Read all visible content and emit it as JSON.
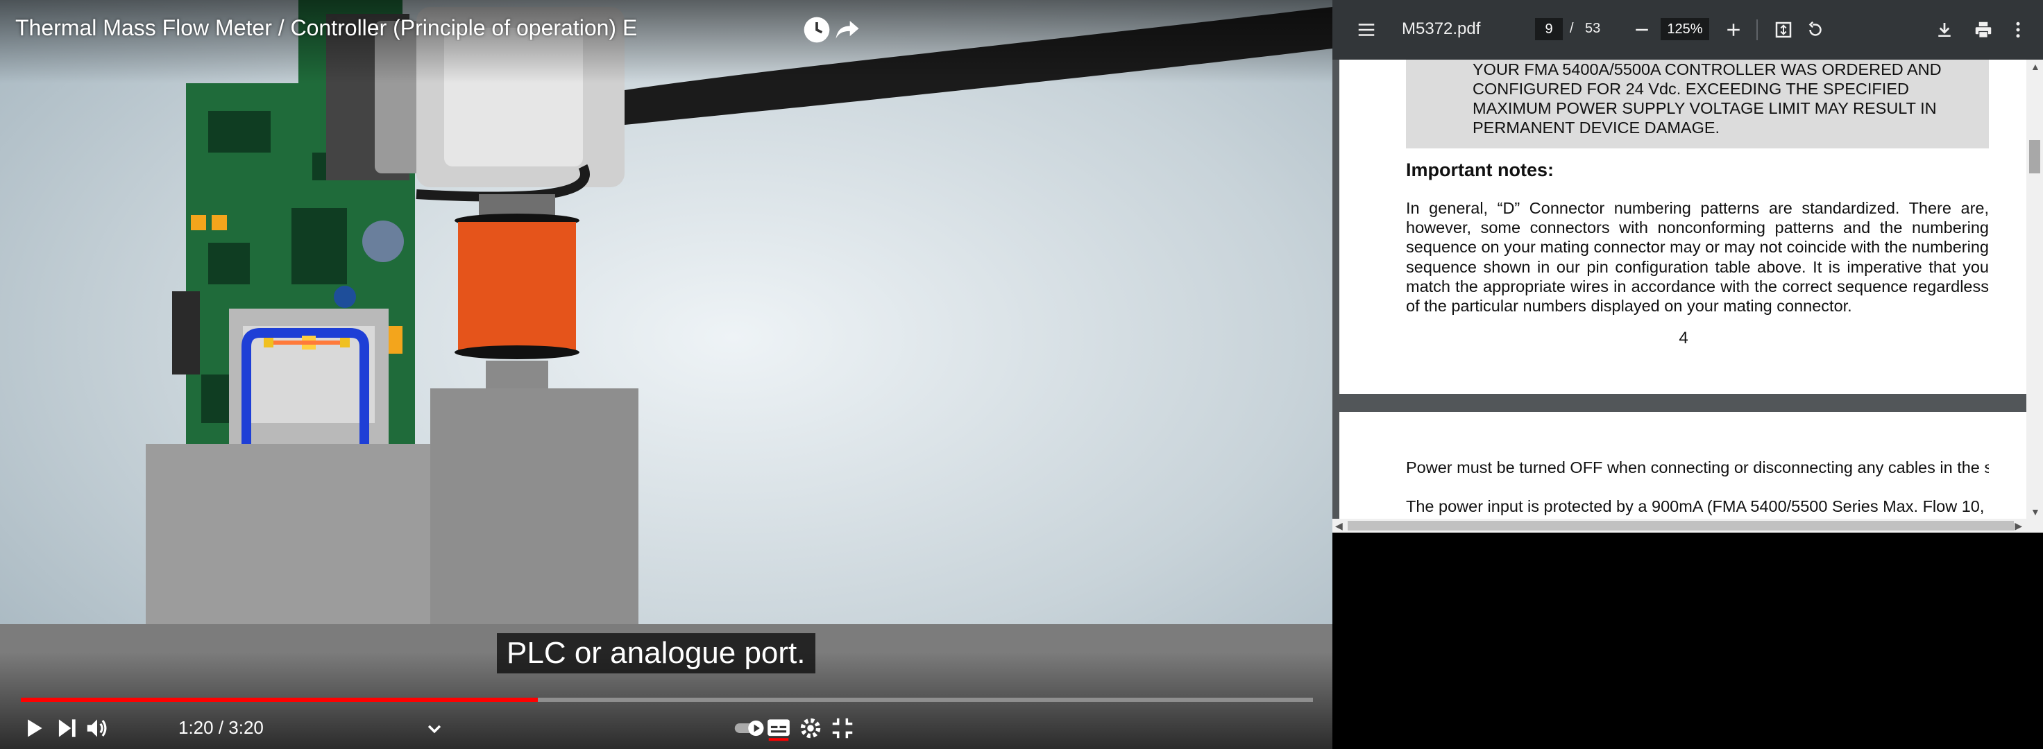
{
  "video": {
    "title": "Thermal Mass Flow Meter / Controller (Principle of operation) E",
    "caption": "PLC or analogue port.",
    "time_display": "1:20 / 3:20",
    "progress_fraction": 0.4,
    "progress_color": "#ff0000",
    "icons": {
      "watch_later": "clock-icon",
      "share": "share-icon",
      "play": "play-icon",
      "next": "next-icon",
      "volume": "volume-icon",
      "chevron": "chevron-down-icon",
      "autoplay": "autoplay-toggle-icon",
      "subtitles": "subtitles-icon",
      "settings": "gear-icon",
      "exit_fullscreen": "exit-fullscreen-icon"
    }
  },
  "pdf": {
    "file_name": "M5372.pdf",
    "current_page": "9",
    "page_separator": "/",
    "total_pages": "53",
    "zoom": "125%",
    "warning_lines": [
      "YOUR FMA 5400A/5500A CONTROLLER WAS ORDERED AND",
      "CONFIGURED FOR 24 Vdc. EXCEEDING THE SPECIFIED",
      "MAXIMUM POWER SUPPLY VOLTAGE LIMIT MAY RESULT IN",
      "PERMANENT DEVICE DAMAGE."
    ],
    "notes_heading": "Important notes:",
    "notes_body": "In general, “D” Connector numbering patterns are standardized. There are, however, some connectors with nonconforming patterns and the numbering sequence on your mating connector may or may not coincide with the numbering sequence shown in our pin configuration table above. It is imperative that you match the appropriate wires in accordance with the correct sequence regardless of the particular numbers displayed on your mating connector.",
    "page_number": "4",
    "next_page_line1": "Power must be turned OFF when connecting or disconnecting any cables in the system.",
    "next_page_line2": "The power input is protected by a 900mA (FMA 5400/5500 Series Max. Flow 10,",
    "icons": {
      "menu": "hamburger-menu-icon",
      "zoom_out": "minus-icon",
      "zoom_in": "plus-icon",
      "fit": "fit-page-icon",
      "rotate": "rotate-icon",
      "download": "download-icon",
      "print": "print-icon",
      "more": "more-vert-icon"
    }
  }
}
